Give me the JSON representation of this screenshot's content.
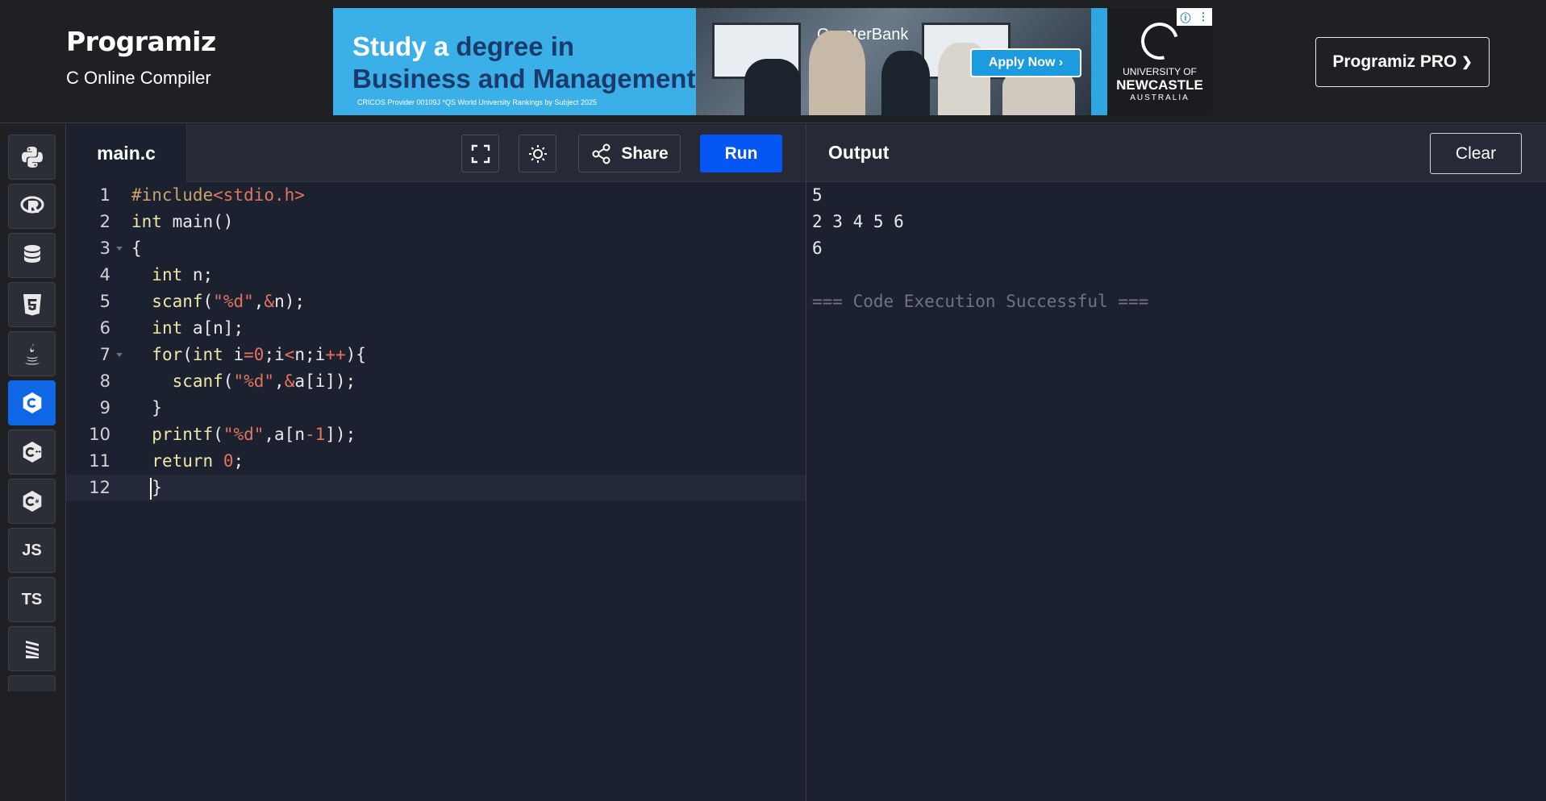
{
  "app": {
    "logo_text": "Programiz",
    "subtitle": "C Online Compiler",
    "pro_button": "Programiz PRO",
    "pro_chevron": "❯"
  },
  "ad": {
    "title_line1_a": "Study a ",
    "title_line1_b": "degree in",
    "title_line2": "Business and Management",
    "fine_print": "CRICOS Provider 00109J     *QS World University Rankings by Subject 2025",
    "brand": "GreaterBank",
    "apply": "Apply Now",
    "uni_l1": "UNIVERSITY OF",
    "uni_l2": "NEWCASTLE",
    "uni_l3": "AUSTRALIA",
    "choices_icons": [
      "info-icon",
      "more-vertical-icon"
    ],
    "colors": {
      "bg": "#3bb0e8",
      "dark_text": "#1a3a6b",
      "button": "#1d9be0"
    }
  },
  "sidebar": {
    "items": [
      {
        "name": "python",
        "icon": "python-icon"
      },
      {
        "name": "r",
        "icon": "r-icon"
      },
      {
        "name": "sql",
        "icon": "database-icon"
      },
      {
        "name": "html",
        "icon": "html5-icon"
      },
      {
        "name": "java",
        "icon": "java-icon"
      },
      {
        "name": "c",
        "icon": "c-icon",
        "active": true
      },
      {
        "name": "cpp",
        "icon": "cpp-icon"
      },
      {
        "name": "csharp",
        "icon": "csharp-icon"
      },
      {
        "name": "javascript",
        "label": "JS"
      },
      {
        "name": "typescript",
        "label": "TS"
      },
      {
        "name": "swift",
        "icon": "swift-icon"
      }
    ]
  },
  "editor": {
    "tab_name": "main.c",
    "share_label": "Share",
    "run_label": "Run",
    "tool_icons": [
      "fullscreen-icon",
      "theme-toggle-icon",
      "share-icon"
    ],
    "line_numbers": [
      "1",
      "2",
      "3",
      "4",
      "5",
      "6",
      "7",
      "8",
      "9",
      "10",
      "11",
      "12"
    ],
    "lines": [
      "#include<stdio.h>",
      "int main()",
      "{",
      "  int n;",
      "  scanf(\"%d\",&n);",
      "  int a[n];",
      "  for(int i=0;i<n;i++){",
      "    scanf(\"%d\",&a[i]);",
      "  }",
      "  printf(\"%d\",a[n-1]);",
      "  return 0;",
      "  }"
    ]
  },
  "output": {
    "title": "Output",
    "clear_label": "Clear",
    "lines": [
      "5",
      "2 3 4 5 6",
      "6",
      "",
      "=== Code Execution Successful ==="
    ]
  },
  "colors": {
    "accent": "#0556f3",
    "active_lang": "#0f67e6",
    "editor_bg": "#1c2130",
    "header_bg": "#1f2024"
  }
}
